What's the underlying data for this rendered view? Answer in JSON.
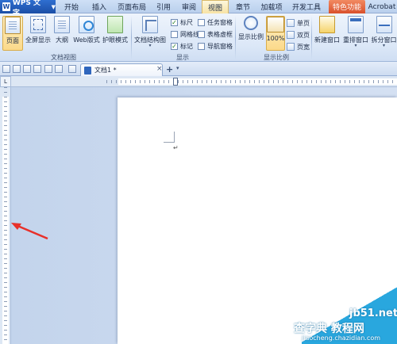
{
  "app": {
    "logo_glyph": "W",
    "name": "WPS 文字",
    "menu_arrow": "▼"
  },
  "menu": [
    {
      "label": "开始"
    },
    {
      "label": "插入"
    },
    {
      "label": "页面布局"
    },
    {
      "label": "引用"
    },
    {
      "label": "审阅"
    },
    {
      "label": "视图"
    },
    {
      "label": "章节"
    },
    {
      "label": "加载项"
    },
    {
      "label": "开发工具"
    },
    {
      "label": "特色功能"
    },
    {
      "label": "Acrobat"
    }
  ],
  "active_menu": "视图",
  "ribbon": {
    "doc_view": {
      "group_label": "文档视图",
      "buttons": [
        {
          "label": "页面",
          "pressed": true
        },
        {
          "label": "全屏显示"
        },
        {
          "label": "大纲"
        },
        {
          "label": "Web版式"
        },
        {
          "label": "护眼模式"
        }
      ]
    },
    "show": {
      "group_label": "显示",
      "doc_map": "文档结构图",
      "checkboxes": [
        {
          "label": "标尺",
          "checked": true
        },
        {
          "label": "网格线",
          "checked": false
        },
        {
          "label": "标记",
          "checked": true
        },
        {
          "label": "任务窗格",
          "checked": false
        },
        {
          "label": "表格虚框",
          "checked": false
        },
        {
          "label": "导航窗格",
          "checked": false
        }
      ]
    },
    "zoom": {
      "group_label": "显示比例",
      "zoom_button": "显示比例",
      "percent_button": "100%",
      "single_page": "单页",
      "two_page": "双页",
      "page_width": "页宽"
    },
    "window": {
      "new_window": "新建窗口",
      "arrange": "重排窗口",
      "split": "拆分窗口"
    }
  },
  "quickbar": {
    "dropdown_glyph": "▾"
  },
  "doc_tab": {
    "title": "文档1 *",
    "close": "×",
    "new_tab": "+",
    "dropdown": "▾"
  },
  "ruler": {
    "corner_glyph": "L"
  },
  "page": {
    "paragraph_mark": "↵"
  },
  "watermark": {
    "site": "jb51.net",
    "name": "查字典 教程网",
    "url": "jiaocheng.chazidian.com"
  },
  "colors": {
    "accent_tab": "#f7e2a2",
    "special_tab": "#d9502b",
    "annotation_arrow": "#e8302a"
  }
}
